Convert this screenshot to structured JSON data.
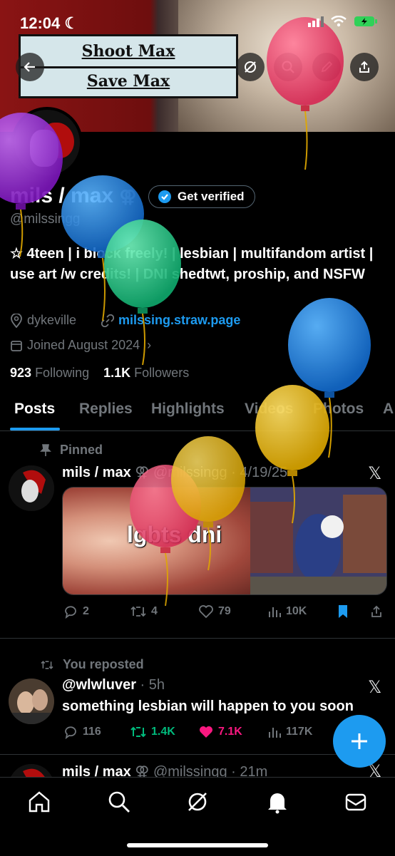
{
  "status_bar": {
    "time": "12:04"
  },
  "banner": {
    "sign_line1": "Shoot Max",
    "sign_line2": "Save Max"
  },
  "profile": {
    "name": "mils / max",
    "pronoun_symbol": "⚢",
    "verify_label": "Get verified",
    "handle": "@milssingg",
    "bio": "☆ 4teen | i block freely! | lesbian | multifandom artist | use art /w credits! | DNI shedtwt, proship, and NSFW",
    "location": "dykeville",
    "website": "milssing.straw.page",
    "joined": "Joined August 2024",
    "following_count": "923",
    "following_label": "Following",
    "followers_count": "1.1K",
    "followers_label": "Followers"
  },
  "tabs": [
    "Posts",
    "Replies",
    "Highlights",
    "Videos",
    "Photos",
    "A"
  ],
  "posts": [
    {
      "context": "Pinned",
      "name": "mils / max",
      "symbol": "⚢",
      "handle": "@milssingg",
      "time": "4/19/25",
      "media_text": "lgbts dni",
      "replies": "2",
      "reposts": "4",
      "likes": "79",
      "views": "10K"
    },
    {
      "context": "You reposted",
      "handle": "@wlwluver",
      "time": "5h",
      "text": "something lesbian will happen to you soon",
      "replies": "116",
      "reposts": "1.4K",
      "likes": "7.1K",
      "views": "117K"
    },
    {
      "name": "mils / max",
      "symbol": "⚢",
      "handle": "@milssingg",
      "time": "21m"
    }
  ],
  "colors": {
    "accent": "#1d9bf0",
    "repost_green": "#00ba7c",
    "like_pink": "#f91880",
    "balloon_purple": "#9b30d9",
    "balloon_pink": "#f0456e",
    "balloon_blue": "#1d8ee0",
    "balloon_green": "#1ed48a",
    "balloon_yellow": "#f2c21a"
  }
}
